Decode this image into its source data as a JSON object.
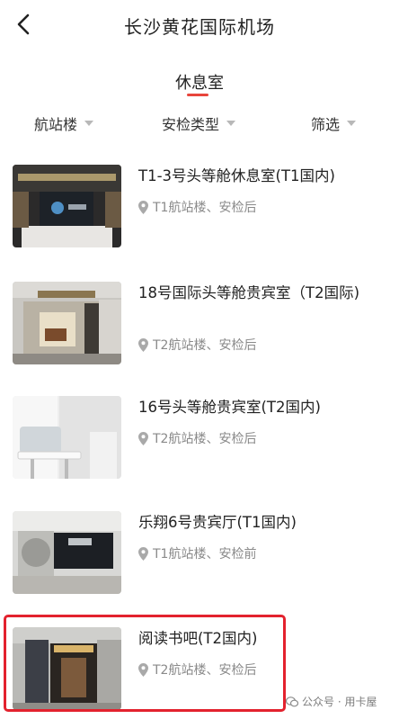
{
  "header": {
    "title": "长沙黄花国际机场"
  },
  "tab": {
    "label": "休息室",
    "accent_color": "#e8453c"
  },
  "filters": [
    {
      "label": "航站楼"
    },
    {
      "label": "安检类型"
    },
    {
      "label": "筛选"
    }
  ],
  "lounges": [
    {
      "name": "T1-3号头等舱休息室(T1国内)",
      "location": "T1航站楼、安检后"
    },
    {
      "name": "18号国际头等舱贵宾室（T2国际)",
      "location": "T2航站楼、安检后"
    },
    {
      "name": "16号头等舱贵宾室(T2国内)",
      "location": "T2航站楼、安检后"
    },
    {
      "name": "乐翔6号贵宾厅(T1国内)",
      "location": "T1航站楼、安检前"
    },
    {
      "name": "阅读书吧(T2国内)",
      "location": "T2航站楼、安检后"
    }
  ],
  "highlight_color": "#e3222e",
  "watermark": {
    "text": "公众号 · 用卡屋",
    "icon": "wechat-icon"
  }
}
